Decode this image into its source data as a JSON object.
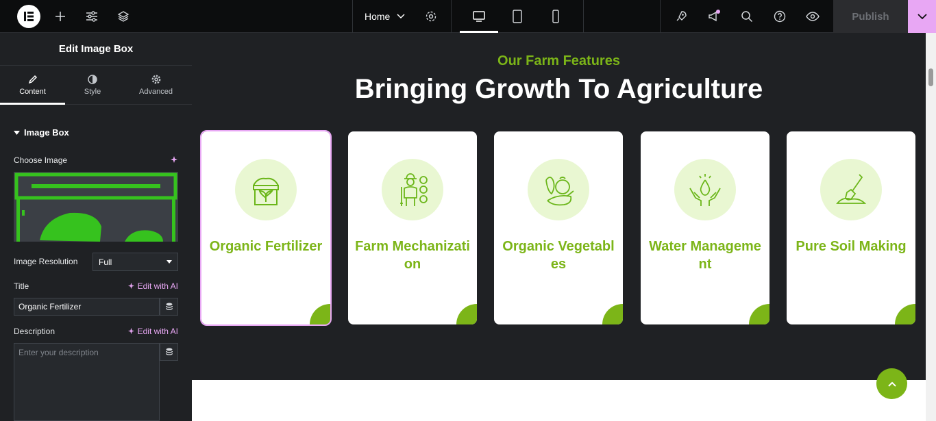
{
  "topbar": {
    "page_name": "Home",
    "publish_label": "Publish"
  },
  "panel": {
    "title": "Edit Image Box",
    "tabs": [
      {
        "label": "Content"
      },
      {
        "label": "Style"
      },
      {
        "label": "Advanced"
      }
    ],
    "section_title": "Image Box",
    "choose_image_label": "Choose Image",
    "image_resolution_label": "Image Resolution",
    "image_resolution_value": "Full",
    "title_label": "Title",
    "title_value": "Organic Fertilizer",
    "edit_with_ai": "Edit with AI",
    "description_label": "Description",
    "description_placeholder": "Enter your description"
  },
  "canvas": {
    "subtitle": "Our Farm Features",
    "heading": "Bringing Growth To Agriculture",
    "cards": [
      {
        "title": "Organic Fertilizer",
        "icon": "fertilizer-box-icon"
      },
      {
        "title": "Farm Mechanization",
        "icon": "farmer-icon"
      },
      {
        "title": "Organic Vegetables",
        "icon": "vegetables-icon"
      },
      {
        "title": "Water Management",
        "icon": "water-hands-icon"
      },
      {
        "title": "Pure Soil Making",
        "icon": "shovel-soil-icon"
      }
    ]
  },
  "colors": {
    "accent_green": "#7cb518",
    "light_green": "#e9f7d2",
    "editor_pink": "#e8a7f4",
    "panel_bg": "#1f2124"
  }
}
